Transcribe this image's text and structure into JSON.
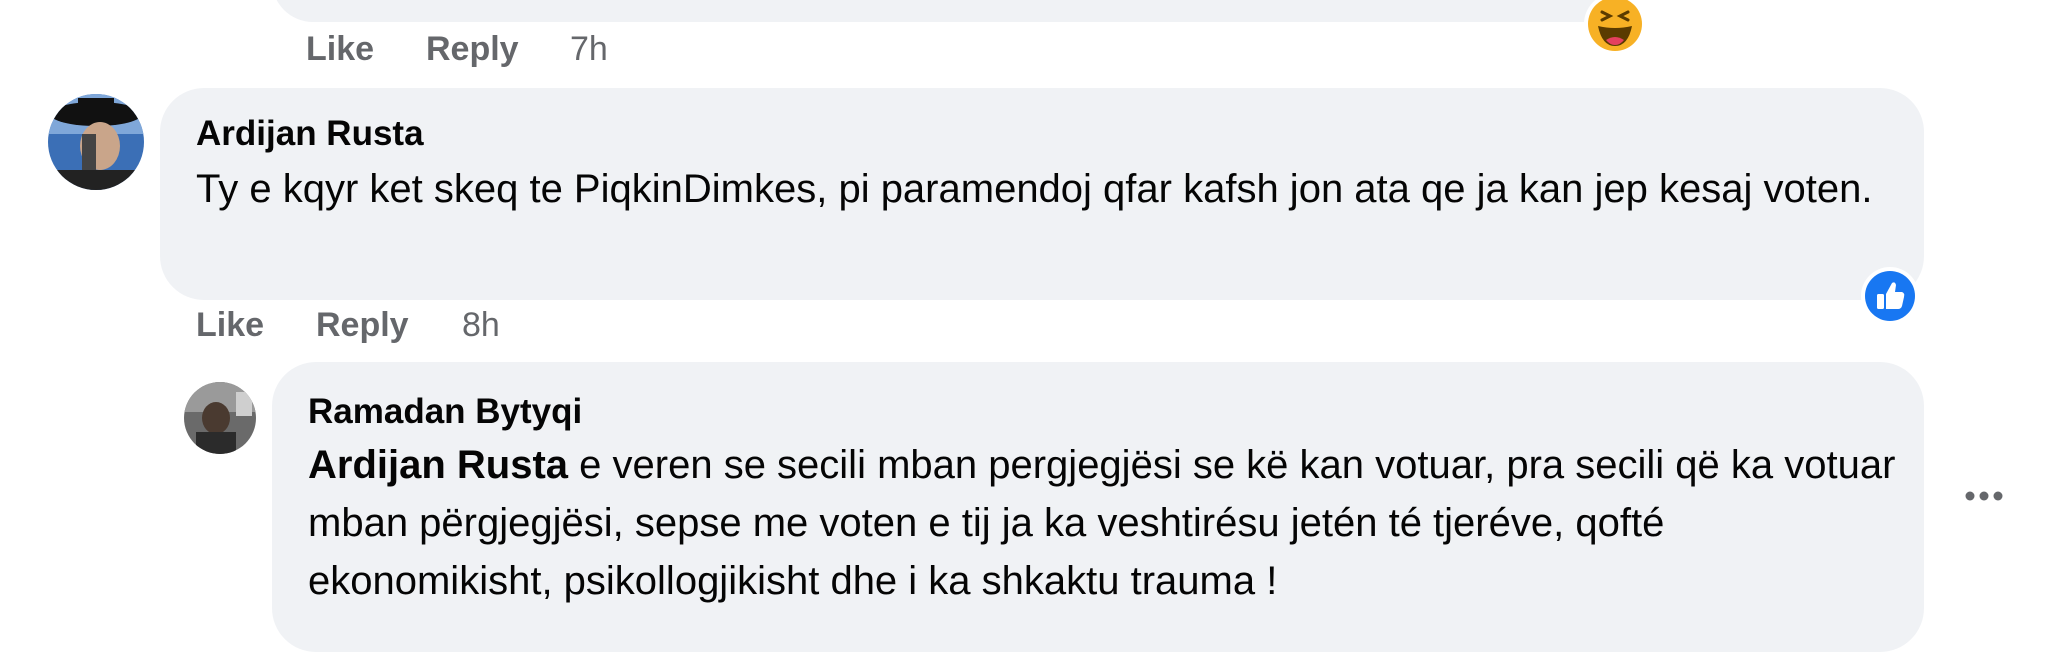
{
  "top_comment": {
    "like_label": "Like",
    "reply_label": "Reply",
    "time": "7h",
    "reaction_icon": "haha-reaction-icon"
  },
  "comment": {
    "author": "Ardijan Rusta",
    "text": "Ty e kqyr ket skeq te PiqkinDimkes, pi paramendoj qfar kafsh jon ata qe ja kan jep kesaj voten.",
    "like_label": "Like",
    "reply_label": "Reply",
    "time": "8h",
    "reaction_icon": "like-reaction-icon",
    "reaction_color": "#1877f2"
  },
  "reply": {
    "author": "Ramadan Bytyqi",
    "mention": "Ardijan Rusta",
    "text": " e veren se secili mban pergjegjësi se kë kan votuar, pra secili që ka votuar mban përgjegjësi, sepse me voten e tij ja ka veshtirésu jetén té tjeréve, qofté ekonomikisht, psikollogjikisht dhe i ka shkaktu trauma !",
    "more_icon": "more-options-icon"
  }
}
